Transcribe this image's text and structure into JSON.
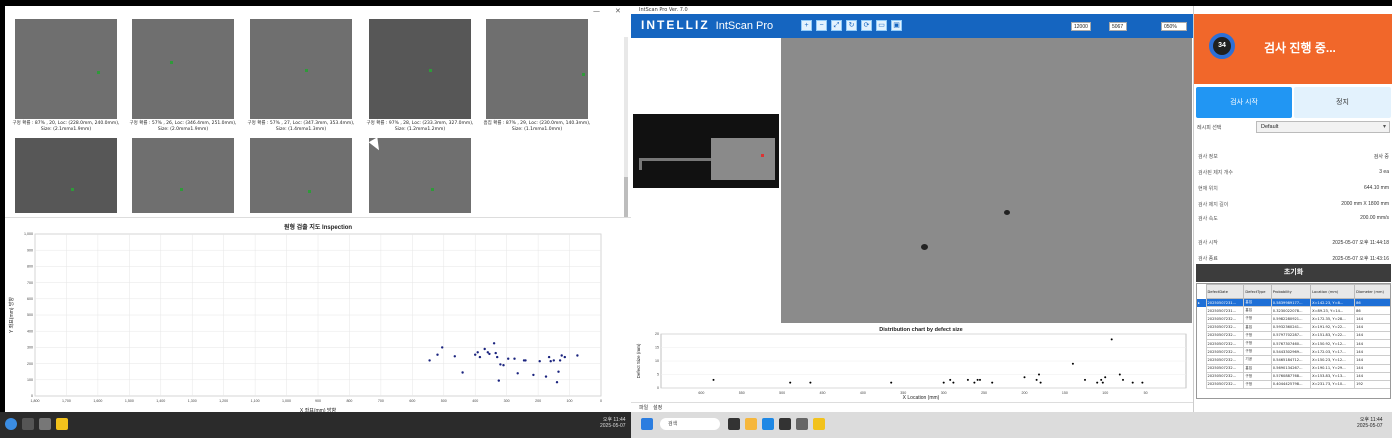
{
  "left_monitor": {
    "window_controls": {
      "min": "—",
      "close": "✕"
    },
    "gallery": {
      "captions": [
        "구멍 확률 : 87% , 20, Loc: (228.0mm, 240.0mm), Size: (2.1mmx1.9mm)",
        "구멍 확률 : 57% , 26, Loc: (346.4mm, 251.0mm), Size: (2.0mmx1.9mm)",
        "구멍 확률 : 57% , 27, Loc: (347.3mm, 353.4mm), Size: (1.4mmx1.3mm)",
        "구멍 확률 : 97% , 28, Loc: (233.3mm, 327.0mm), Size: (1.2mmx1.2mm)",
        "흠집 확률 : 87% , 29, Loc: (230.0mm, 140.3mm), Size: (1.1mmx1.0mm)"
      ]
    },
    "chart_title": "원형 검출 지도 Inspection",
    "xlabel": "X 좌표(mm) 방향",
    "ylabel": "Y 좌표(mm) 방향",
    "clock": {
      "time": "오후 11:44",
      "date": "2025-05-07"
    }
  },
  "chart_data": [
    {
      "type": "scatter",
      "title": "원형 검출 지도 Inspection",
      "xlabel": "X 좌표(mm) 방향",
      "ylabel": "Y 좌표(mm) 방향",
      "xlim": [
        1800,
        0
      ],
      "ylim": [
        0,
        1000
      ],
      "xticks": [
        "1,800",
        "1,700",
        "1,600",
        "1,500",
        "1,400",
        "1,300",
        "1,200",
        "1,100",
        "1,000",
        "900",
        "800",
        "700",
        "600",
        "500",
        "400",
        "300",
        "200",
        "100",
        "0"
      ],
      "yticks": [
        "0",
        "100",
        "200",
        "300",
        "400",
        "500",
        "600",
        "700",
        "800",
        "900",
        "1,000"
      ],
      "points": [
        [
          545,
          220
        ],
        [
          520,
          255
        ],
        [
          505,
          300
        ],
        [
          465,
          245
        ],
        [
          440,
          145
        ],
        [
          400,
          255
        ],
        [
          392,
          270
        ],
        [
          385,
          240
        ],
        [
          370,
          290
        ],
        [
          360,
          270
        ],
        [
          355,
          260
        ],
        [
          340,
          325
        ],
        [
          335,
          265
        ],
        [
          330,
          240
        ],
        [
          325,
          95
        ],
        [
          320,
          195
        ],
        [
          310,
          190
        ],
        [
          295,
          230
        ],
        [
          275,
          230
        ],
        [
          265,
          140
        ],
        [
          245,
          220
        ],
        [
          240,
          220
        ],
        [
          215,
          130
        ],
        [
          195,
          215
        ],
        [
          175,
          120
        ],
        [
          165,
          240
        ],
        [
          160,
          215
        ],
        [
          150,
          220
        ],
        [
          140,
          85
        ],
        [
          135,
          150
        ],
        [
          130,
          220
        ],
        [
          125,
          250
        ],
        [
          115,
          240
        ],
        [
          75,
          250
        ]
      ]
    },
    {
      "type": "scatter",
      "title": "Distribution chart by defect size",
      "xlabel": "X Location (mm)",
      "ylabel": "Defect Size (mm)",
      "xlim": [
        0,
        1
      ],
      "ylim": [
        0,
        20
      ],
      "yticks": [
        "0",
        "5",
        "10",
        "15",
        "20"
      ],
      "xticks": [
        "600",
        "550",
        "500",
        "450",
        "400",
        "350",
        "300",
        "250",
        "200",
        "150",
        "100",
        "50"
      ],
      "points_x_mm": [
        585,
        490,
        465,
        365,
        300,
        292,
        288,
        270,
        262,
        258,
        255,
        240,
        200,
        185,
        182,
        180,
        140,
        125,
        110,
        105,
        103,
        100,
        92,
        82,
        78,
        66,
        54
      ],
      "points_size": [
        3,
        2,
        2,
        2,
        2,
        3,
        2,
        3,
        2,
        3,
        3,
        2,
        4,
        3,
        5,
        2,
        9,
        3,
        2,
        3,
        2,
        4,
        18,
        5,
        3,
        2,
        2
      ]
    }
  ],
  "right_monitor": {
    "window_title": "IntScan Pro Ver. 7.0",
    "brand": "INTELLIZ",
    "product": "IntScan Pro",
    "header_fields": {
      "w": "12000",
      "h": "5067",
      "zoom": "050%"
    },
    "dist_chart_title": "Distribution chart by defect size",
    "bottom_tabs": [
      "파일",
      "설정"
    ],
    "status": {
      "count": "34",
      "text": "검사 진행 중..."
    },
    "tabs": {
      "start": "검사 시작",
      "stop": "정지"
    },
    "recipe": {
      "label": "레시피 선택",
      "value": "Default"
    },
    "info": [
      {
        "k": "검사 정보",
        "v": "검사 중"
      },
      {
        "k": "검사된 제지 개수",
        "v": "3 ea"
      },
      {
        "k": "현재 위치",
        "v": "644.10 mm"
      },
      {
        "k": "검사 제지 길이",
        "v": "2000 mm X 1800 mm"
      },
      {
        "k": "검사 속도",
        "v": "200.00 mm/s"
      },
      {
        "k": "검사 시작",
        "v": "2025-05-07 오후 11:44:18"
      },
      {
        "k": "검사 종료",
        "v": "2025-05-07 오후 11:43:16"
      }
    ],
    "reset_label": "초기화",
    "table": {
      "headers": [
        "DefectDate",
        "DefectType",
        "Probability",
        "Location (mm)",
        "Diameter (mm)"
      ],
      "rows": [
        [
          "20250507231...",
          "흠집",
          "0.5839989177...",
          "X=142.23, Y=8...",
          "86"
        ],
        [
          "20250507231...",
          "흠집",
          "0.3230022078...",
          "X=89.23, Y=14...",
          "86"
        ],
        [
          "20250507232...",
          "구멍",
          "0.5982280921...",
          "X=172.35, Y=28...",
          "144"
        ],
        [
          "20250507232...",
          "흠집",
          "0.5932360241...",
          "X=191.92, Y=22...",
          "144"
        ],
        [
          "20250507232...",
          "구멍",
          "0.5797702287...",
          "X=151.83, Y=22...",
          "144"
        ],
        [
          "20250507232...",
          "구멍",
          "0.5767307460...",
          "X=150.92, Y=12...",
          "144"
        ],
        [
          "20250507232...",
          "구멍",
          "0.5443302969...",
          "X=172.03, Y=17...",
          "144"
        ],
        [
          "20250507232...",
          "기공",
          "0.5465184712...",
          "X=150.23, Y=12...",
          "144"
        ],
        [
          "20250507232...",
          "흠집",
          "0.5690134267...",
          "X=190.11, Y=29...",
          "144"
        ],
        [
          "20250507232...",
          "구멍",
          "0.5760887768...",
          "X=153.83, Y=13...",
          "144"
        ],
        [
          "20250507232...",
          "구멍",
          "0.4044425798...",
          "X=231.73, Y=10...",
          "192"
        ]
      ]
    },
    "taskbar": {
      "search": "검색",
      "time": "오후 11:44",
      "date": "2025-05-07"
    }
  }
}
